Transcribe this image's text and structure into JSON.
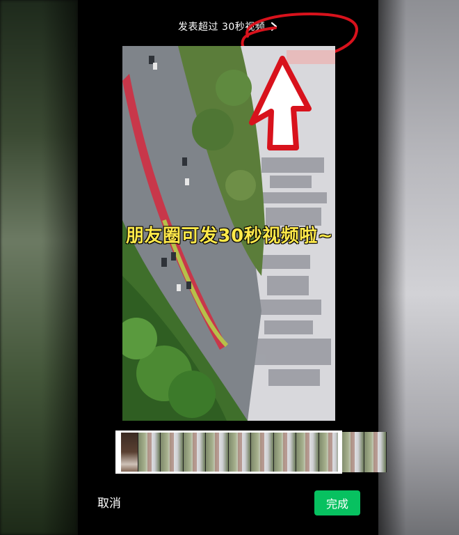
{
  "header": {
    "publish_link_label": "发表超过 30秒视频"
  },
  "video": {
    "caption": "朋友圈可发30秒视频啦~"
  },
  "footer": {
    "cancel_label": "取消",
    "done_label": "完成"
  },
  "colors": {
    "done_button": "#07c160",
    "annotation_red": "#d8121c",
    "caption_yellow": "#ffe94a"
  },
  "icons": {
    "publish_link": "chevron-right-icon"
  }
}
